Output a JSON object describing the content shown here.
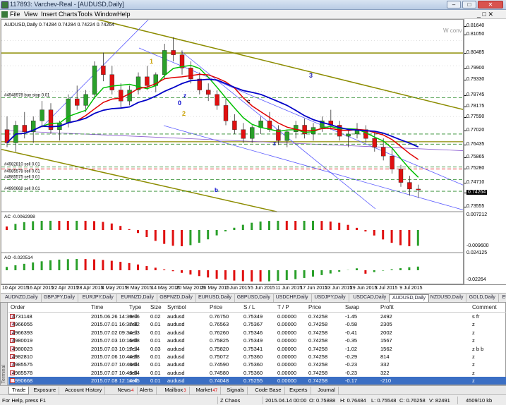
{
  "window": {
    "title": "117893: Varchev-Real - [AUDUSD,Daily]"
  },
  "menu": [
    "File",
    "View",
    "Insert",
    "Charts",
    "Tools",
    "Window",
    "Help"
  ],
  "chart": {
    "symbol_label": "AUDUSD,Daily  0.74284 0.74284 0.74224 0.74264",
    "watermark": "W conv",
    "price_levels": [
      "0.81640",
      "0.81050",
      "0.80485",
      "0.79900",
      "0.79330",
      "0.78745",
      "0.78175",
      "0.77590",
      "0.77020",
      "0.76435",
      "0.75865",
      "0.75280",
      "0.74710",
      "0.74264",
      "0.73555"
    ],
    "current_price": "0.74264",
    "order_labels": [
      "#4948978 buy stop 0.01",
      "#4982810 sell 0.01",
      "#4985575 sell 0.01",
      "#4990668 sell 0.01",
      "#4985578 sell 0.01"
    ],
    "ac_label": "AC -0.0062998",
    "ac_levels": [
      "0.007212",
      "-0.009600"
    ],
    "ao_label": "AO -0.020514",
    "ao_levels": [
      "0.024125",
      "-0.02264"
    ],
    "wave_labels": [
      "1",
      "2",
      "3",
      "0",
      "b",
      "c",
      "z",
      "z"
    ],
    "candles": [
      [
        0.77,
        0.776,
        0.762,
        0.764
      ],
      [
        0.764,
        0.774,
        0.76,
        0.772
      ],
      [
        0.772,
        0.778,
        0.766,
        0.769
      ],
      [
        0.769,
        0.776,
        0.764,
        0.774
      ],
      [
        0.774,
        0.783,
        0.771,
        0.779
      ],
      [
        0.779,
        0.782,
        0.768,
        0.77
      ],
      [
        0.77,
        0.774,
        0.765,
        0.773
      ],
      [
        0.773,
        0.786,
        0.771,
        0.784
      ],
      [
        0.784,
        0.79,
        0.779,
        0.781
      ],
      [
        0.781,
        0.788,
        0.778,
        0.786
      ],
      [
        0.786,
        0.801,
        0.784,
        0.799
      ],
      [
        0.799,
        0.805,
        0.792,
        0.795
      ],
      [
        0.795,
        0.799,
        0.786,
        0.788
      ],
      [
        0.788,
        0.791,
        0.78,
        0.783
      ],
      [
        0.783,
        0.79,
        0.781,
        0.788
      ],
      [
        0.788,
        0.796,
        0.786,
        0.794
      ],
      [
        0.794,
        0.799,
        0.788,
        0.79
      ],
      [
        0.79,
        0.796,
        0.787,
        0.795
      ],
      [
        0.795,
        0.809,
        0.793,
        0.806
      ],
      [
        0.806,
        0.812,
        0.801,
        0.804
      ],
      [
        0.804,
        0.806,
        0.795,
        0.798
      ],
      [
        0.798,
        0.801,
        0.791,
        0.793
      ],
      [
        0.793,
        0.796,
        0.786,
        0.788
      ],
      [
        0.788,
        0.791,
        0.783,
        0.786
      ],
      [
        0.786,
        0.788,
        0.779,
        0.781
      ],
      [
        0.781,
        0.784,
        0.772,
        0.774
      ],
      [
        0.774,
        0.777,
        0.768,
        0.77
      ],
      [
        0.77,
        0.773,
        0.764,
        0.766
      ],
      [
        0.766,
        0.772,
        0.764,
        0.771
      ],
      [
        0.771,
        0.776,
        0.768,
        0.774
      ],
      [
        0.774,
        0.778,
        0.769,
        0.77
      ],
      [
        0.77,
        0.772,
        0.763,
        0.765
      ],
      [
        0.765,
        0.77,
        0.762,
        0.769
      ],
      [
        0.769,
        0.774,
        0.766,
        0.772
      ],
      [
        0.772,
        0.775,
        0.766,
        0.768
      ],
      [
        0.768,
        0.773,
        0.765,
        0.771
      ],
      [
        0.771,
        0.776,
        0.769,
        0.774
      ],
      [
        0.774,
        0.779,
        0.77,
        0.772
      ],
      [
        0.772,
        0.774,
        0.765,
        0.767
      ],
      [
        0.767,
        0.77,
        0.762,
        0.768
      ],
      [
        0.768,
        0.773,
        0.766,
        0.77
      ],
      [
        0.77,
        0.772,
        0.764,
        0.766
      ],
      [
        0.766,
        0.769,
        0.76,
        0.762
      ],
      [
        0.762,
        0.766,
        0.756,
        0.758
      ],
      [
        0.758,
        0.762,
        0.75,
        0.752
      ],
      [
        0.752,
        0.754,
        0.744,
        0.746
      ],
      [
        0.746,
        0.749,
        0.74,
        0.743
      ],
      [
        0.743,
        0.745,
        0.739,
        0.7426
      ]
    ]
  },
  "price_axis_label_x": "",
  "time_labels": [
    "10 Apr 2015",
    "16 Apr 2015",
    "22 Apr 2015",
    "28 Apr 2015",
    "4 May 2015",
    "8 May 2015",
    "14 May 2015",
    "20 May 2015",
    "26 May 2015",
    "1 Jun 2015",
    "5 Jun 2015",
    "11 Jun 2015",
    "17 Jun 2015",
    "23 Jun 2015",
    "29 Jun 2015",
    "3 Jul 2015",
    "9 Jul 2015"
  ],
  "chart_tabs": [
    "AUDNZD,Daily",
    "GBPJPY,Daily",
    "EURJPY,Daily",
    "EURNZD,Daily",
    "GBPNZD,Daily",
    "EURUSD,Daily",
    "GBPUSD,Daily",
    "USDCHF,Daily",
    "USDJPY,Daily",
    "USDCAD,Daily",
    "AUDUSD,Daily",
    "NZDUSD,Daily",
    "GOLD,Daily",
    "EURO"
  ],
  "active_chart_tab": "AUDUSD,Daily",
  "trade_table": {
    "headers": [
      "Order",
      "Time",
      "Type",
      "Size",
      "Symbol",
      "Price",
      "S / L",
      "T / P",
      "Price",
      "Swap",
      "Profit",
      "Comment"
    ],
    "rows": [
      [
        "4731148",
        "2015.06.26 14:39:16",
        "sell",
        "0.02",
        "audusd",
        "0.76750",
        "0.75349",
        "0.00000",
        "0.74258",
        "-1.45",
        "2492",
        "s fr"
      ],
      [
        "4966055",
        "2015.07.01 16:37:32",
        "sell",
        "0.01",
        "audusd",
        "0.76563",
        "0.75367",
        "0.00000",
        "0.74258",
        "-0.58",
        "2305",
        "z"
      ],
      [
        "4966393",
        "2015.07.02 09:34:13",
        "sell",
        "0.01",
        "audusd",
        "0.76260",
        "0.75346",
        "0.00000",
        "0.74258",
        "-0.41",
        "2002",
        "z"
      ],
      [
        "4980019",
        "2015.07.03 10:16:08",
        "sell",
        "0.01",
        "audusd",
        "0.75825",
        "0.75349",
        "0.00000",
        "0.74258",
        "-0.35",
        "1567",
        "z"
      ],
      [
        "4980023",
        "2015.07.03 10:17:14",
        "sell",
        "0.03",
        "audusd",
        "0.75820",
        "0.75341",
        "0.00000",
        "0.74258",
        "-1.02",
        "1562",
        "z b b"
      ],
      [
        "4982810",
        "2015.07.06 10:44:28",
        "sell",
        "0.01",
        "audusd",
        "0.75072",
        "0.75360",
        "0.00000",
        "0.74258",
        "-0.29",
        "814",
        "z"
      ],
      [
        "4985575",
        "2015.07.07 10:43:04",
        "sell",
        "0.01",
        "audusd",
        "0.74590",
        "0.75360",
        "0.00000",
        "0.74258",
        "-0.23",
        "332",
        "z"
      ],
      [
        "4985578",
        "2015.07.07 10:43:04",
        "sell",
        "0.01",
        "audusd",
        "0.74580",
        "0.75360",
        "0.00000",
        "0.74258",
        "-0.23",
        "322",
        "z"
      ],
      [
        "4990668",
        "2015.07.08 12:14:45",
        "sell",
        "0.01",
        "audusd",
        "0.74048",
        "0.75255",
        "0.00000",
        "0.74258",
        "-0.17",
        "-210",
        "z"
      ]
    ]
  },
  "terminal_tabs": [
    "Trade",
    "Exposure",
    "Account History",
    "News",
    "Alerts",
    "Mailbox",
    "Market",
    "Signals",
    "Code Base",
    "Experts",
    "Journal"
  ],
  "terminal_tab_badges": {
    "News": "4",
    "Mailbox": "3",
    "Market": "47"
  },
  "active_terminal_tab": "Trade",
  "terminal_side_label": "Terminal",
  "status": {
    "help": "For Help, press F1",
    "profile": "Z Chaos",
    "datetime": "2015.04.14 00:00",
    "open": "O: 0.75888",
    "high": "H: 0.76484",
    "low": "L: 0.75548",
    "close": "C: 0.76258",
    "volume": "V: 82491",
    "traffic": "4509/10 kb"
  },
  "colors": {
    "bull": "#2aa02a",
    "bear": "#e01010",
    "ma_red": "#e00000",
    "ma_blue": "#0000c8",
    "ma_green": "#00c000",
    "channel_olive": "#8c8c00",
    "channel_blue": "#5a5aff",
    "order_line": "#2a8a2a"
  }
}
